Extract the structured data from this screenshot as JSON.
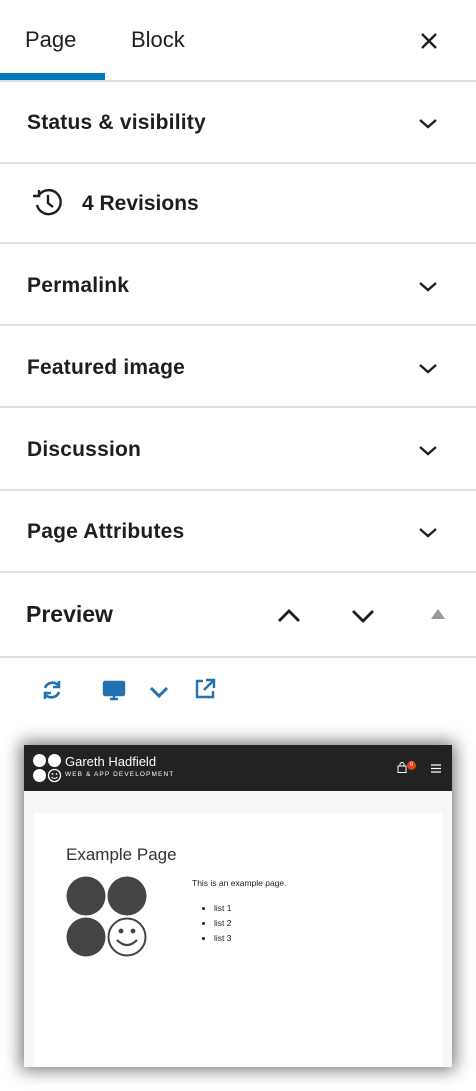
{
  "tabs": [
    {
      "label": "Page",
      "active": true
    },
    {
      "label": "Block",
      "active": false
    }
  ],
  "close_icon": "close-icon",
  "panels": {
    "status": "Status & visibility",
    "revisions": "4 Revisions",
    "permalink": "Permalink",
    "featured_image": "Featured image",
    "discussion": "Discussion",
    "page_attributes": "Page Attributes",
    "preview": "Preview"
  },
  "preview_toolbar": {
    "icons": [
      "refresh-icon",
      "desktop-icon",
      "chevron-down-icon",
      "external-link-icon"
    ],
    "accent": "#2271b1"
  },
  "preview_site": {
    "site_name": "Gareth Hadfield",
    "tagline": "WEB & APP DEVELOPMENT",
    "cart_count": "0",
    "page_title": "Example Page",
    "body_text": "This is an example page.",
    "list_items": [
      "list 1",
      "list 2",
      "list 3"
    ]
  },
  "colors": {
    "accent": "#007cba",
    "divider": "#e0e0e0",
    "site_header": "#222222",
    "cart_badge": "#e2401c"
  }
}
